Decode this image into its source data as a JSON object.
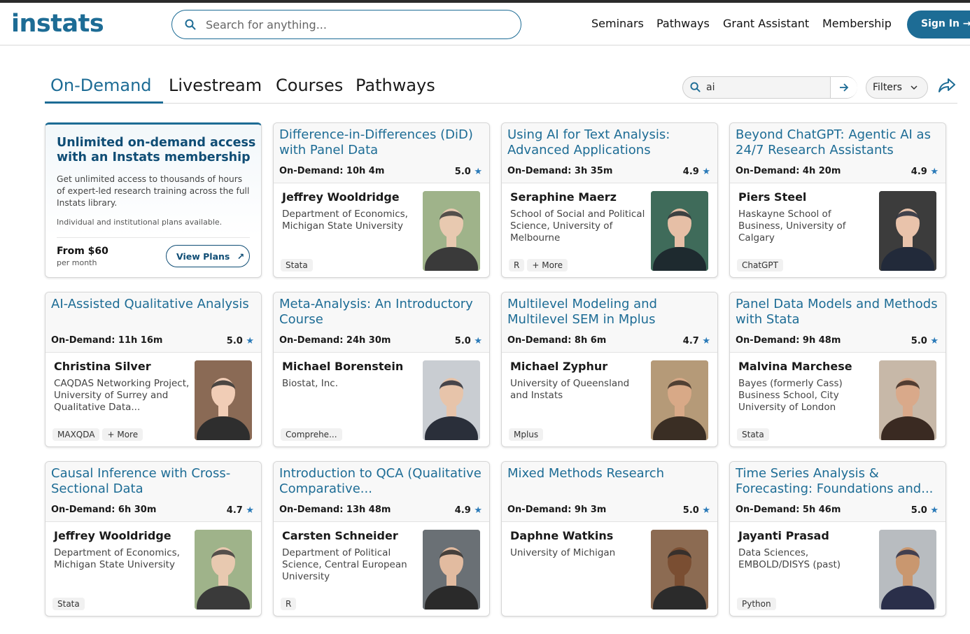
{
  "header": {
    "logo": "instats",
    "search_placeholder": "Search for anything...",
    "nav": [
      "Seminars",
      "Pathways",
      "Grant Assistant",
      "Membership"
    ],
    "signin": "Sign In"
  },
  "tabs": [
    "On-Demand",
    "Livestream",
    "Courses",
    "Pathways"
  ],
  "active_tab": "On-Demand",
  "query": {
    "value": "ai"
  },
  "filters_label": "Filters",
  "promo": {
    "title": "Unlimited on-demand access with an Instats membership",
    "desc": "Get unlimited access to thousands of hours of expert-led research training across the full Instats library.",
    "note": "Individual and institutional plans available.",
    "price": "From $60",
    "per": "per month",
    "button": "View Plans"
  },
  "cards": [
    {
      "title": "Difference-in-Differences (DiD) with Panel Data",
      "duration": "On-Demand: 10h 4m",
      "rating": "5.0",
      "name": "Jeffrey Wooldridge",
      "affiliation": "Department of Economics, Michigan State University",
      "tags": [
        "Stata"
      ]
    },
    {
      "title": "Using AI for Text Analysis: Advanced Applications",
      "duration": "On-Demand: 3h 35m",
      "rating": "4.9",
      "name": "Seraphine Maerz",
      "affiliation": "School of Social and Political Science, University of Melbourne",
      "tags": [
        "R",
        "+ More"
      ]
    },
    {
      "title": "Beyond ChatGPT: Agentic AI as 24/7 Research Assistants",
      "duration": "On-Demand: 4h 20m",
      "rating": "4.9",
      "name": "Piers Steel",
      "affiliation": "Haskayne School of Business, University of Calgary",
      "tags": [
        "ChatGPT"
      ]
    },
    {
      "title": "AI-Assisted Qualitative Analysis",
      "duration": "On-Demand: 11h 16m",
      "rating": "5.0",
      "name": "Christina Silver",
      "affiliation": "CAQDAS Networking Project, University of Surrey and Qualitative Data...",
      "tags": [
        "MAXQDA",
        "+ More"
      ]
    },
    {
      "title": "Meta-Analysis: An Introductory Course",
      "duration": "On-Demand: 24h 30m",
      "rating": "5.0",
      "name": "Michael Borenstein",
      "affiliation": "Biostat, Inc.",
      "tags": [
        "Comprehe..."
      ]
    },
    {
      "title": "Multilevel Modeling and Multilevel SEM in Mplus",
      "duration": "On-Demand: 8h 6m",
      "rating": "4.7",
      "name": "Michael Zyphur",
      "affiliation": "University of Queensland and Instats",
      "tags": [
        "Mplus"
      ]
    },
    {
      "title": "Panel Data Models and Methods with Stata",
      "duration": "On-Demand: 9h 48m",
      "rating": "5.0",
      "name": "Malvina Marchese",
      "affiliation": "Bayes (formerly Cass) Business School, City University of London",
      "tags": [
        "Stata"
      ]
    },
    {
      "title": "Causal Inference with Cross-Sectional Data",
      "duration": "On-Demand: 6h 30m",
      "rating": "4.7",
      "name": "Jeffrey Wooldridge",
      "affiliation": "Department of Economics, Michigan State University",
      "tags": [
        "Stata"
      ]
    },
    {
      "title": "Introduction to QCA (Qualitative Comparative...",
      "duration": "On-Demand: 13h 48m",
      "rating": "4.9",
      "name": "Carsten Schneider",
      "affiliation": "Department of Political Science, Central European University",
      "tags": [
        "R"
      ]
    },
    {
      "title": "Mixed Methods Research",
      "duration": "On-Demand: 9h 3m",
      "rating": "5.0",
      "name": "Daphne Watkins",
      "affiliation": "University of Michigan",
      "tags": []
    },
    {
      "title": "Time Series Analysis & Forecasting: Foundations and...",
      "duration": "On-Demand: 5h 46m",
      "rating": "5.0",
      "name": "Jayanti Prasad",
      "affiliation": "Data Sciences, EMBOLD/DISYS (past)",
      "tags": [
        "Python"
      ]
    }
  ],
  "colors": {
    "brand": "#1d6c95",
    "star": "#2a7ab8"
  }
}
